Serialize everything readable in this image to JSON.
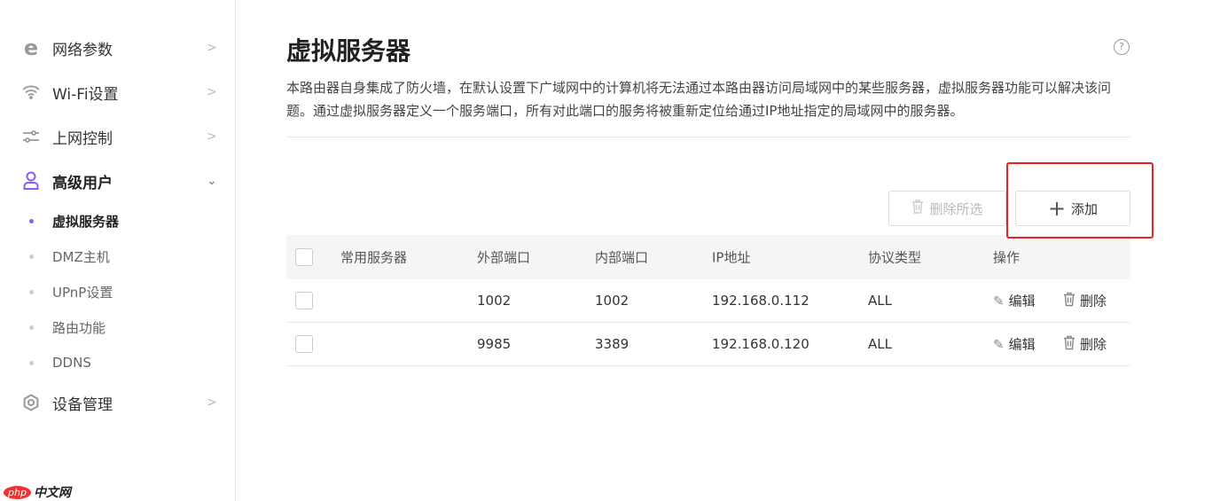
{
  "sidebar": {
    "items": [
      {
        "label": "网络参数",
        "icon": "ie-icon"
      },
      {
        "label": "Wi-Fi设置",
        "icon": "wifi-icon"
      },
      {
        "label": "上网控制",
        "icon": "sliders-icon"
      },
      {
        "label": "高级用户",
        "icon": "user-icon"
      },
      {
        "label": "设备管理",
        "icon": "gear-icon"
      }
    ],
    "subitems": [
      {
        "label": "虚拟服务器"
      },
      {
        "label": "DMZ主机"
      },
      {
        "label": "UPnP设置"
      },
      {
        "label": "路由功能"
      },
      {
        "label": "DDNS"
      }
    ]
  },
  "watermark": {
    "php": "php",
    "cn": "中文网"
  },
  "page": {
    "title": "虚拟服务器",
    "help": "?",
    "description": "本路由器自身集成了防火墙，在默认设置下广域网中的计算机将无法通过本路由器访问局域网中的某些服务器，虚拟服务器功能可以解决该问题。通过虚拟服务器定义一个服务端口，所有对此端口的服务将被重新定位给通过IP地址指定的局域网中的服务器。",
    "delete_selected": "删除所选",
    "add": "添加"
  },
  "table": {
    "headers": [
      "常用服务器",
      "外部端口",
      "内部端口",
      "IP地址",
      "协议类型",
      "操作"
    ],
    "rows": [
      {
        "server": "",
        "ext": "1002",
        "int": "1002",
        "ip": "192.168.0.112",
        "proto": "ALL"
      },
      {
        "server": "",
        "ext": "9985",
        "int": "3389",
        "ip": "192.168.0.120",
        "proto": "ALL"
      }
    ],
    "edit": "编辑",
    "delete": "删除"
  }
}
